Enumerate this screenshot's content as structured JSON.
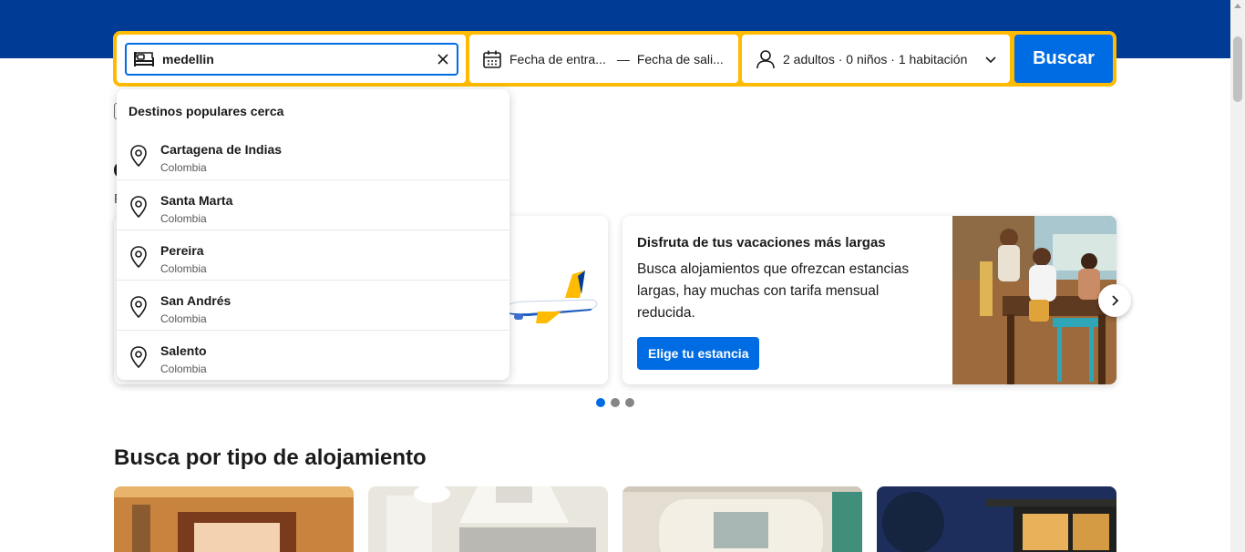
{
  "search": {
    "destination_value": "medellin",
    "checkin_label": "Fecha de entra...",
    "date_separator": "—",
    "checkout_label": "Fecha de sali...",
    "guests_label": "2 adultos · 0 niños · 1 habitación",
    "search_button": "Buscar"
  },
  "dropdown": {
    "title": "Destinos populares cerca",
    "items": [
      {
        "name": "Cartagena de Indias",
        "country": "Colombia"
      },
      {
        "name": "Santa Marta",
        "country": "Colombia"
      },
      {
        "name": "Pereira",
        "country": "Colombia"
      },
      {
        "name": "San Andrés",
        "country": "Colombia"
      },
      {
        "name": "Salento",
        "country": "Colombia"
      }
    ]
  },
  "promo_card": {
    "title": "Disfruta de tus vacaciones más largas",
    "body": "Busca alojamientos que ofrezcan estancias largas, hay muchas con tarifa mensual reducida.",
    "cta": "Elige tu estancia"
  },
  "peek": {
    "heading_letter": "O",
    "subtext_letter": "P"
  },
  "section": {
    "title": "Busca por tipo de alojamiento"
  },
  "colors": {
    "brand_blue": "#003b95",
    "action_blue": "#006ce4",
    "search_yellow": "#febb02"
  },
  "icons": {
    "destination": "bed-icon",
    "clear": "close-icon",
    "dates": "calendar-icon",
    "guests": "person-icon",
    "expand": "chevron-down-icon",
    "location": "map-pin-icon",
    "carousel_next": "chevron-right-icon"
  }
}
